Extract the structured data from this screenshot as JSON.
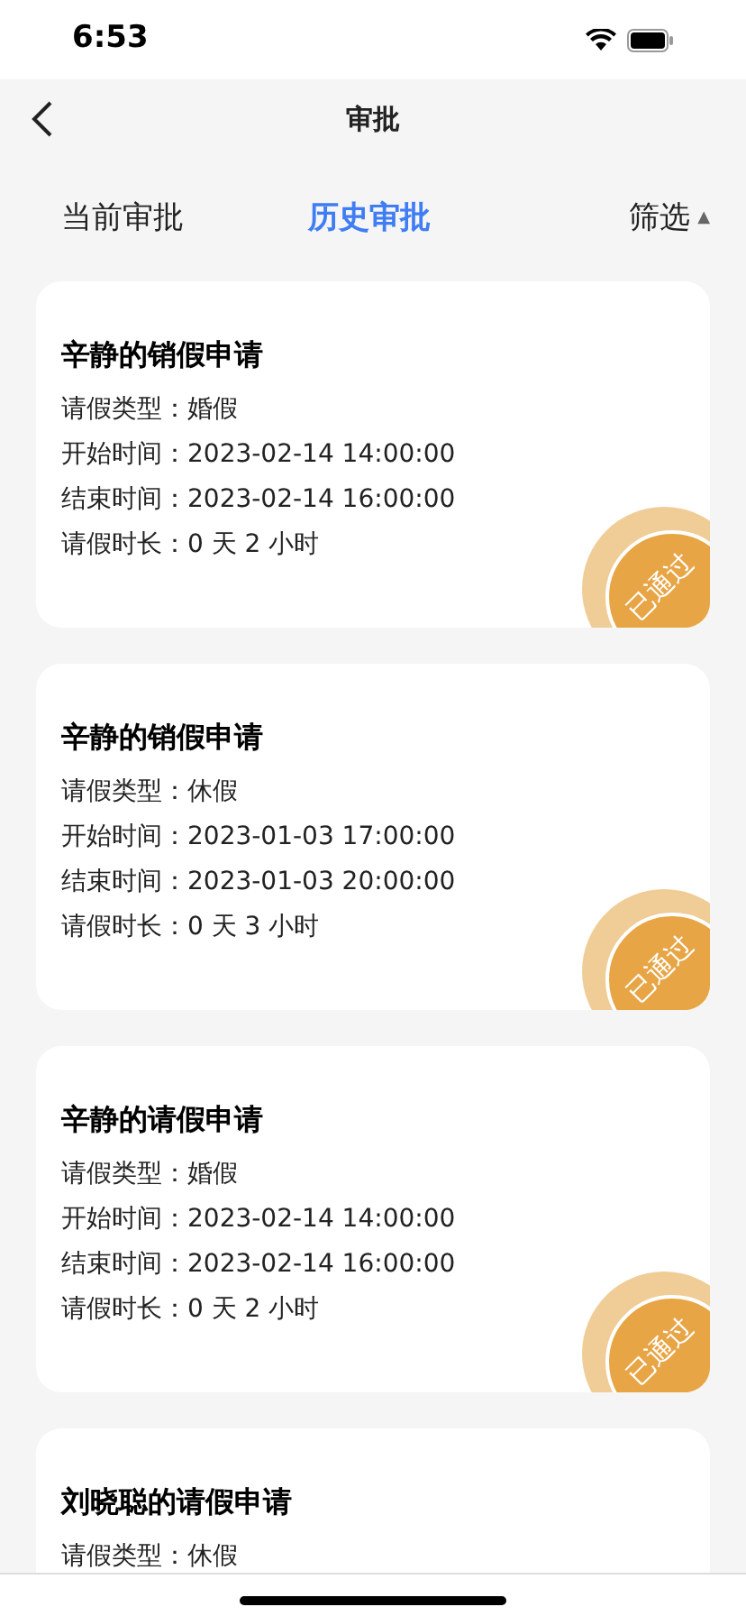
{
  "status_bar": {
    "time": "6:53"
  },
  "header": {
    "title": "审批"
  },
  "tabs": [
    {
      "label": "当前审批",
      "selected": false
    },
    {
      "label": "历史审批",
      "selected": true
    }
  ],
  "filter": {
    "label": "筛选",
    "arrow": "▲"
  },
  "cards": [
    {
      "title": "辛静的销假申请",
      "rows": [
        "请假类型：婚假",
        "开始时间：2023-02-14 14:00:00",
        "结束时间：2023-02-14 16:00:00",
        "请假时长：0 天 2 小时"
      ],
      "stamp": "已通过"
    },
    {
      "title": "辛静的销假申请",
      "rows": [
        "请假类型：休假",
        "开始时间：2023-01-03 17:00:00",
        "结束时间：2023-01-03 20:00:00",
        "请假时长：0 天 3 小时"
      ],
      "stamp": "已通过"
    },
    {
      "title": "辛静的请假申请",
      "rows": [
        "请假类型：婚假",
        "开始时间：2023-02-14 14:00:00",
        "结束时间：2023-02-14 16:00:00",
        "请假时长：0 天 2 小时"
      ],
      "stamp": "已通过"
    },
    {
      "title": "刘晓聪的请假申请",
      "rows": [
        "请假类型：休假"
      ]
    }
  ]
}
